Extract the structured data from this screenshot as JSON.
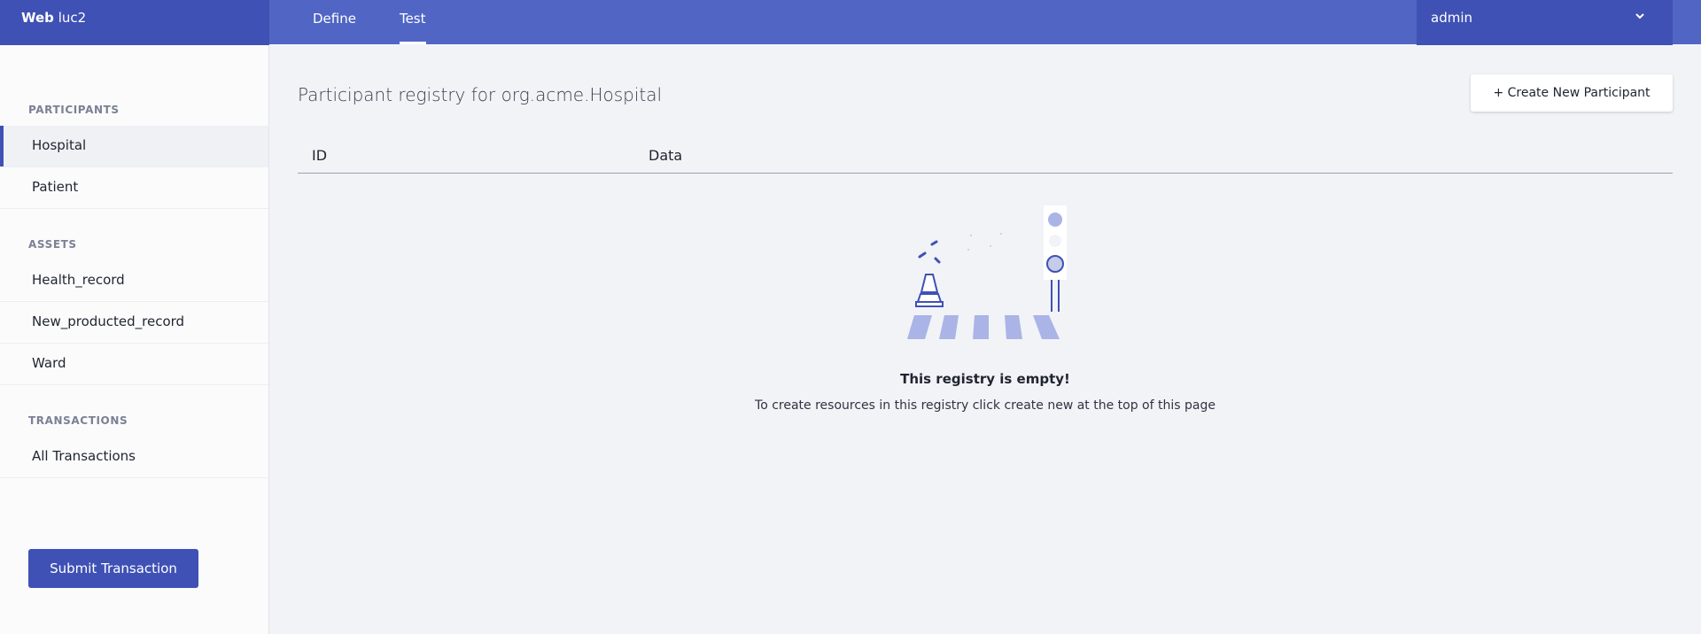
{
  "app": {
    "brand_bold": "Web",
    "brand_rest": " luc2"
  },
  "tabs": [
    {
      "label": "Define",
      "active": false
    },
    {
      "label": "Test",
      "active": true
    }
  ],
  "user": {
    "name": "admin"
  },
  "sidebar": {
    "participants_title": "PARTICIPANTS",
    "participants": [
      {
        "label": "Hospital",
        "active": true
      },
      {
        "label": "Patient",
        "active": false
      }
    ],
    "assets_title": "ASSETS",
    "assets": [
      {
        "label": "Health_record"
      },
      {
        "label": "New_producted_record"
      },
      {
        "label": "Ward"
      }
    ],
    "transactions_title": "TRANSACTIONS",
    "transactions": [
      {
        "label": "All Transactions"
      }
    ],
    "submit_label": "Submit Transaction"
  },
  "main": {
    "title": "Participant registry for org.acme.Hospital",
    "create_label": "+ Create New Participant",
    "columns": {
      "id": "ID",
      "data": "Data"
    },
    "empty_title": "This registry is empty!",
    "empty_text": "To create resources in this registry click create new at the top of this page"
  },
  "colors": {
    "topbar": "#5065c4",
    "accent": "#3f51b5",
    "illustration": "#aab4e6"
  },
  "icons": [
    "chevron-down-icon",
    "empty-registry-illustration"
  ]
}
